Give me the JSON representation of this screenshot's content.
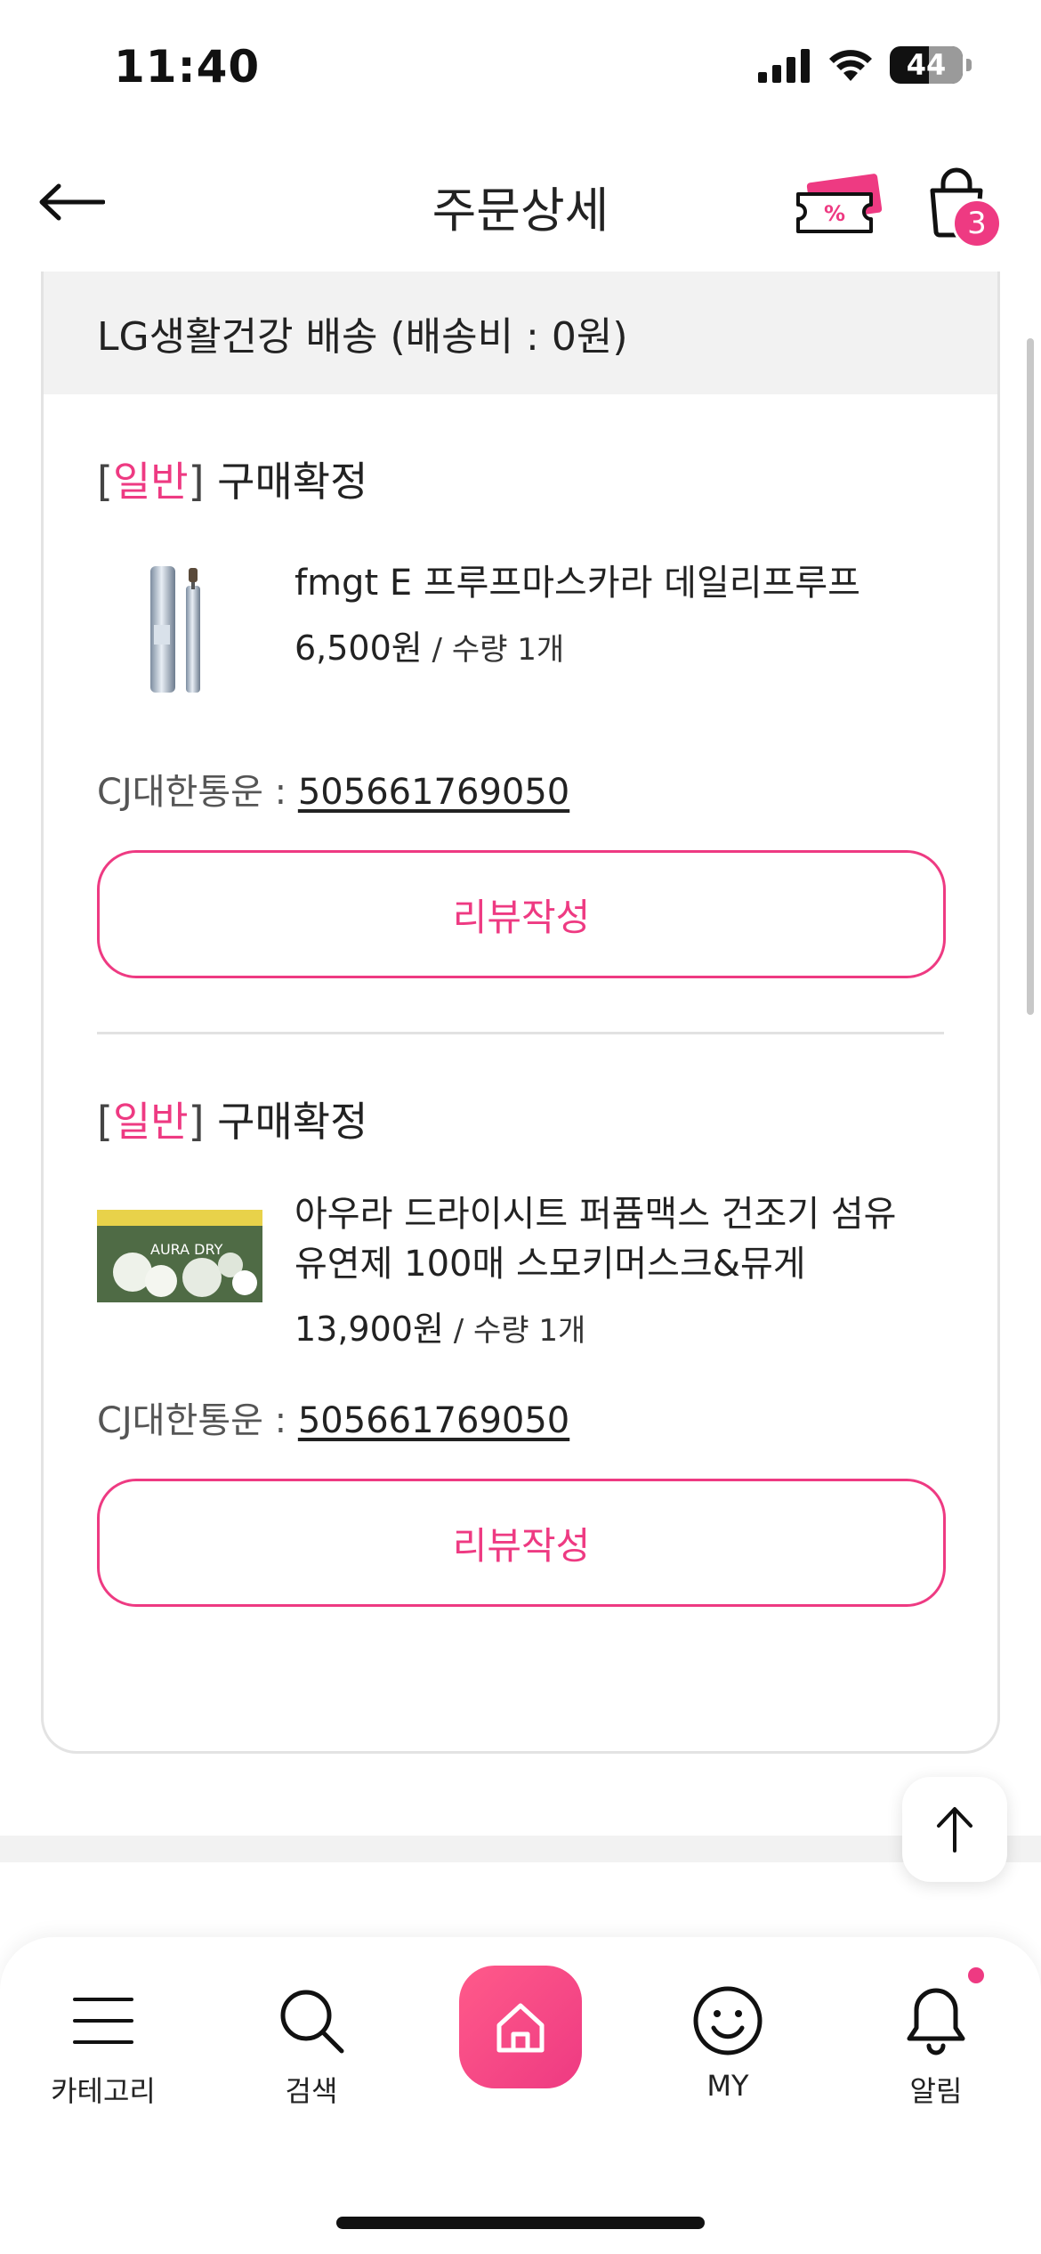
{
  "status_bar": {
    "time": "11:40",
    "battery": "44"
  },
  "header": {
    "title": "주문상세",
    "cart_count": "3"
  },
  "order": {
    "shipping_header": "LG생활건강 배송 (배송비 : 0원)",
    "items": [
      {
        "bracket_open": "[",
        "type": "일반",
        "bracket_close": "]",
        "status": " 구매확정",
        "name": "fmgt E 프루프마스카라 데일리프루프",
        "price": "6,500원",
        "qty_sep": " / ",
        "qty": "수량 1개",
        "carrier": "CJ대한통운 : ",
        "tracking": "505661769050",
        "review_label": "리뷰작성"
      },
      {
        "bracket_open": "[",
        "type": "일반",
        "bracket_close": "]",
        "status": " 구매확정",
        "name": "아우라 드라이시트 퍼퓸맥스 건조기 섬유유연제 100매 스모키머스크&뮤게",
        "price": "13,900원",
        "qty_sep": " / ",
        "qty": "수량 1개",
        "carrier": "CJ대한통운 : ",
        "tracking": "505661769050",
        "review_label": "리뷰작성",
        "thumb_brand": "AURA DRY"
      }
    ]
  },
  "nav": {
    "category": "카테고리",
    "search": "검색",
    "my": "MY",
    "alerts": "알림"
  },
  "colors": {
    "accent": "#ee3a82"
  },
  "icons": [
    "back-arrow-icon",
    "coupon-icon",
    "cart-icon",
    "menu-icon",
    "search-icon",
    "home-icon",
    "smiley-icon",
    "bell-icon",
    "arrow-up-icon"
  ]
}
